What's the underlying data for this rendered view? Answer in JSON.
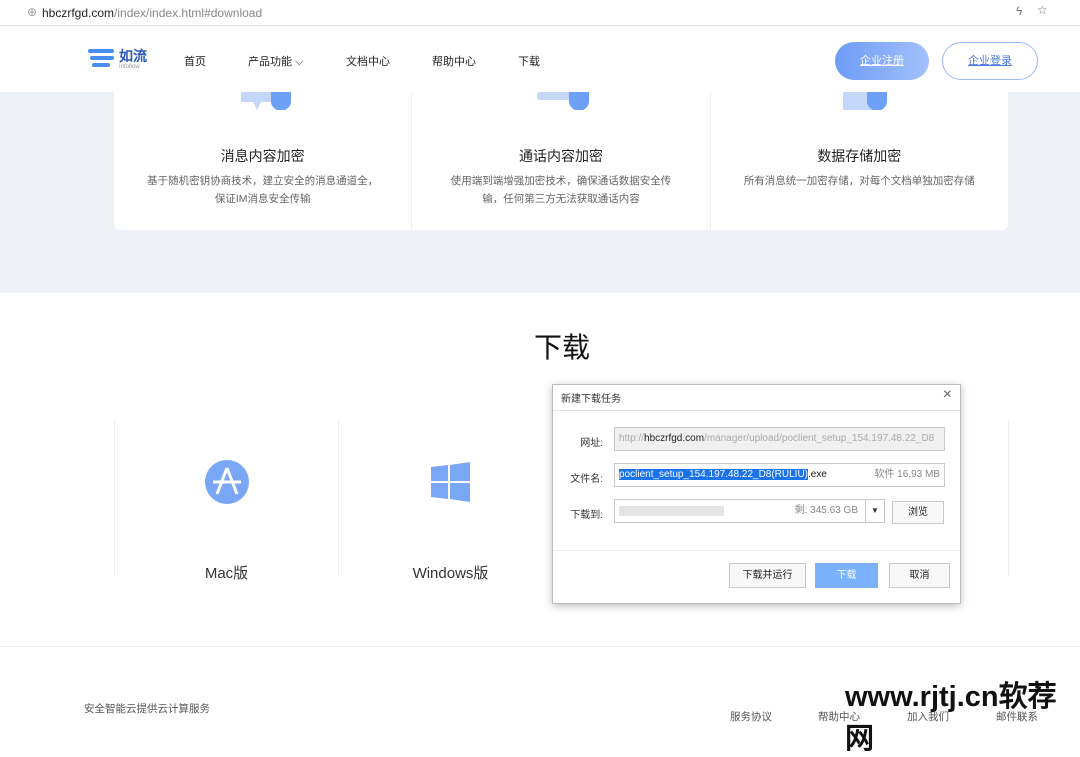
{
  "browser": {
    "url_domain": "hbczrfgd.com",
    "url_path": "/index/index.html#download"
  },
  "header": {
    "logo_text": "如流",
    "logo_sub": "Infoflow",
    "nav": [
      "首页",
      "产品功能",
      "文档中心",
      "帮助中心",
      "下载"
    ],
    "register": "企业注册",
    "login": "企业登录"
  },
  "features": [
    {
      "title": "消息内容加密",
      "desc": "基于随机密钥协商技术，建立安全的消息通道全，保证IM消息安全传输"
    },
    {
      "title": "通话内容加密",
      "desc": "使用端到端增强加密技术，确保通话数据安全传输，任何第三方无法获取通话内容"
    },
    {
      "title": "数据存储加密",
      "desc": "所有消息统一加密存储，对每个文档单独加密存储"
    }
  ],
  "download": {
    "title": "下载",
    "mac": "Mac版",
    "windows": "Windows版"
  },
  "dialog": {
    "title": "新建下载任务",
    "url_label": "网址:",
    "url_prefix": "http://",
    "url_domain": "hbczrfgd.com",
    "url_rest": "/manager/upload/poclient_setup_154.197.48.22_D8",
    "name_label": "文件名:",
    "name_selected": "poclient_setup_154.197.48.22_D8(RULIU)",
    "name_ext": ".exe",
    "file_info": "软件 16.93 MB",
    "dest_label": "下载到:",
    "free_space": "剩: 345.63 GB",
    "browse": "浏览",
    "run": "下载并运行",
    "download": "下载",
    "cancel": "取消"
  },
  "footer": {
    "tagline": "安全智能云提供云计算服务",
    "links": [
      "服务协议",
      "帮助中心",
      "加入我们",
      "邮件联系"
    ]
  },
  "watermark": "www.rjtj.cn软荐网"
}
